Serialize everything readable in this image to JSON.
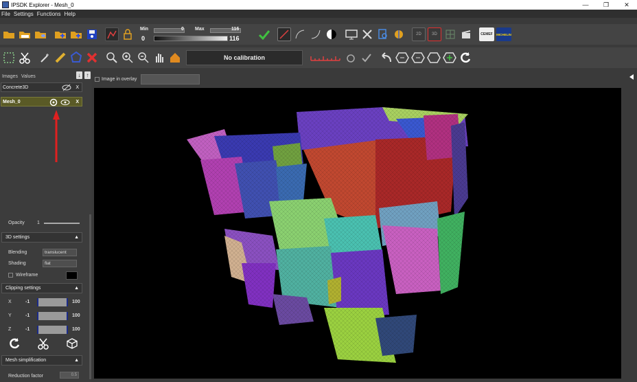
{
  "window": {
    "title": "IPSDK Explorer - Mesh_0",
    "controls": [
      "—",
      "❐",
      "✕"
    ]
  },
  "menu": [
    "File",
    "Settings",
    "Functions",
    "Help"
  ],
  "toolbar1": {
    "min_label": "Min",
    "max_label": "Max",
    "min_top_value": "0",
    "max_top_value": "116",
    "min_value": "0",
    "max_value": "116",
    "view2d": "2D",
    "view3d": "3D",
    "logo1": "CEMEF",
    "logo2": "MICHELIN"
  },
  "toolbar2": {
    "calibration": "No calibration"
  },
  "left_panel": {
    "tabs": [
      "Images",
      "Values"
    ],
    "layers": [
      {
        "name": "Concrete3D",
        "close": "X"
      },
      {
        "name": "Mesh_0",
        "close": "X"
      }
    ],
    "opacity_label": "Opacity",
    "opacity_value": "1",
    "settings3d": "3D settings",
    "blending_label": "Blending",
    "blending_value": "translucent",
    "shading_label": "Shading",
    "shading_value": "flat",
    "wireframe_label": "Wireframe",
    "clipping": "Clipping settings",
    "clip_rows": [
      {
        "axis": "X",
        "min": "-1",
        "max": "100"
      },
      {
        "axis": "Y",
        "min": "-1",
        "max": "100"
      },
      {
        "axis": "Z",
        "min": "-1",
        "max": "100"
      }
    ],
    "mesh_simplification": "Mesh simplification",
    "reduction_label": "Reduction factor",
    "reduction_value": "0.5"
  },
  "viewer": {
    "overlay_label": "Image in overlay"
  }
}
